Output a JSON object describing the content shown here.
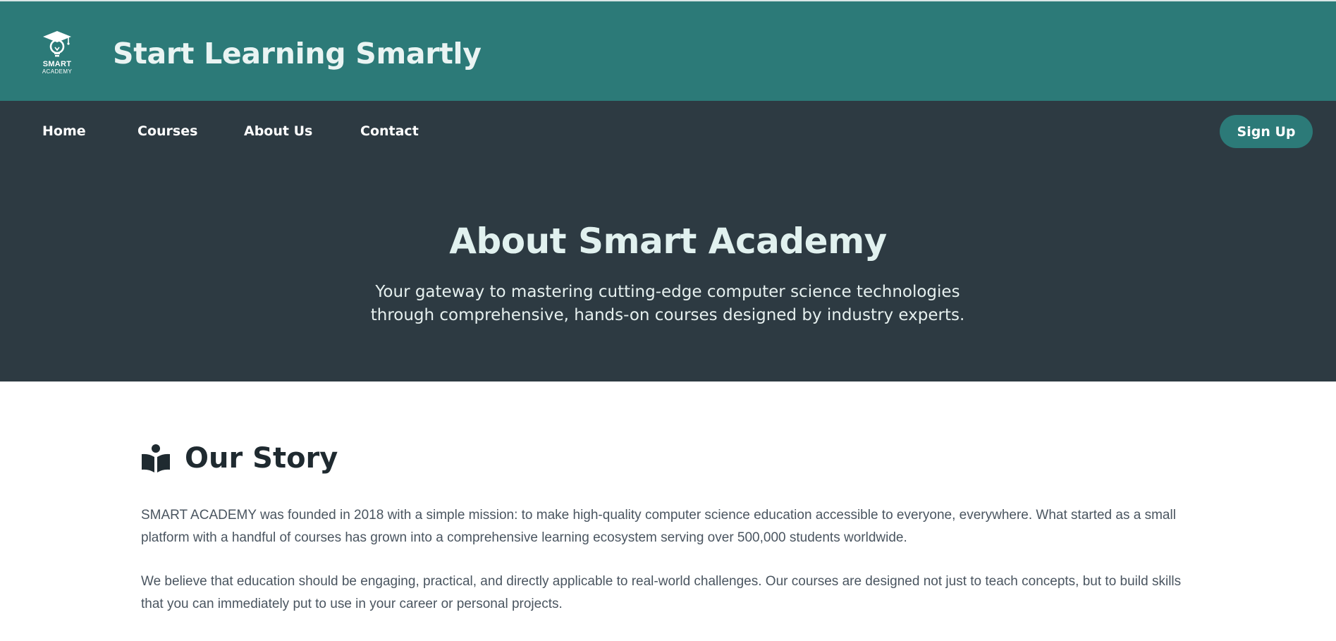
{
  "header": {
    "logo": {
      "line1": "SMART",
      "line2": "ACADEMY",
      "icon": "lightbulb-graduation-cap-icon"
    },
    "title": "Start Learning Smartly"
  },
  "nav": {
    "items": [
      {
        "label": "Home"
      },
      {
        "label": "Courses"
      },
      {
        "label": "About Us"
      },
      {
        "label": "Contact"
      }
    ],
    "signup_label": "Sign Up"
  },
  "hero": {
    "title": "About Smart Academy",
    "subtitle": "Your gateway to mastering cutting-edge computer science technologies through comprehensive, hands-on courses designed by industry experts."
  },
  "story": {
    "icon": "book-reader-icon",
    "title": "Our Story",
    "paragraphs": [
      "SMART ACADEMY was founded in 2018 with a simple mission: to make high-quality computer science education accessible to everyone, everywhere. What started as a small platform with a handful of courses has grown into a comprehensive learning ecosystem serving over 500,000 students worldwide.",
      "We believe that education should be engaging, practical, and directly applicable to real-world challenges. Our courses are designed not just to teach concepts, but to build skills that you can immediately put to use in your career or personal projects."
    ]
  },
  "colors": {
    "header_bg": "#2c7a78",
    "nav_bg": "#2d3a42",
    "accent": "#2c7a78",
    "text_dark": "#1f2a30",
    "text_body": "#4a5560"
  }
}
